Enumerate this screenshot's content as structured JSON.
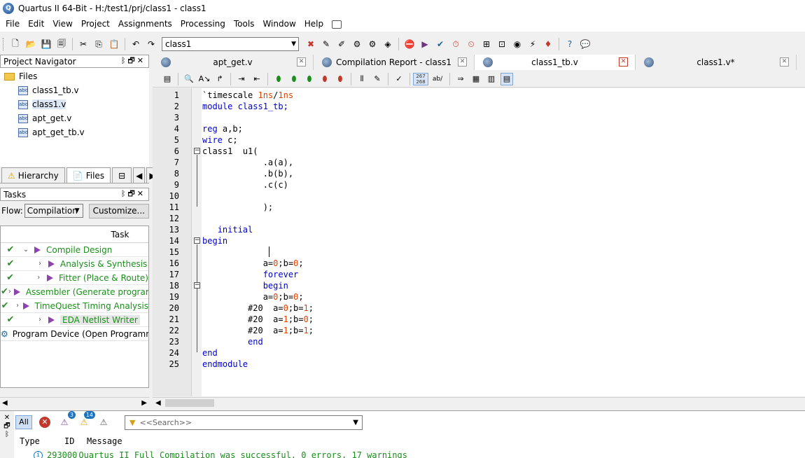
{
  "window": {
    "title": "Quartus II 64-Bit - H:/test1/prj/class1 - class1"
  },
  "menu": [
    "File",
    "Edit",
    "View",
    "Project",
    "Assignments",
    "Processing",
    "Tools",
    "Window",
    "Help"
  ],
  "toolbar": {
    "entity_value": "class1"
  },
  "nav": {
    "title": "Project Navigator",
    "folder": "Files",
    "files": [
      "class1_tb.v",
      "class1.v",
      "apt_get.v",
      "apt_get_tb.v"
    ],
    "selected_index": 1,
    "tabs": [
      "Hierarchy",
      "Files"
    ]
  },
  "tasks": {
    "title": "Tasks",
    "flow_label": "Flow:",
    "flow_value": "Compilation",
    "customize": "Customize...",
    "column": "Task",
    "rows": [
      {
        "label": "Compile Design",
        "done": true,
        "indent": 0
      },
      {
        "label": "Analysis & Synthesis",
        "done": true,
        "indent": 1
      },
      {
        "label": "Fitter (Place & Route)",
        "done": true,
        "indent": 1
      },
      {
        "label": "Assembler (Generate programming files)",
        "done": true,
        "indent": 1
      },
      {
        "label": "TimeQuest Timing Analysis",
        "done": true,
        "indent": 1
      },
      {
        "label": "EDA Netlist Writer",
        "done": true,
        "indent": 1
      },
      {
        "label": "Program Device (Open Programmer)",
        "done": false,
        "indent": 0
      }
    ]
  },
  "editor": {
    "tabs": [
      "apt_get.v",
      "Compilation Report - class1",
      "class1_tb.v",
      "class1.v*"
    ],
    "active_tab": 2,
    "lines_btn": "267\n268",
    "ab_btn": "ab/",
    "lines": [
      [
        [
          "`timescale ",
          ""
        ],
        [
          "1ns",
          "num"
        ],
        [
          "/",
          ""
        ],
        [
          "1ns",
          "num"
        ]
      ],
      [
        [
          "module class1_tb;",
          "kw0"
        ]
      ],
      [],
      [
        [
          "reg",
          "kw"
        ],
        [
          " a,b;",
          ""
        ]
      ],
      [
        [
          "wire",
          "kw"
        ],
        [
          " c;",
          ""
        ]
      ],
      [
        [
          "class1  u1(",
          ""
        ]
      ],
      [
        [
          "            .a(a),",
          ""
        ]
      ],
      [
        [
          "            .b(b),",
          ""
        ]
      ],
      [
        [
          "            .c(c)",
          ""
        ]
      ],
      [],
      [
        [
          "            );",
          ""
        ]
      ],
      [],
      [
        [
          "   ",
          ""
        ],
        [
          "initial",
          "kw"
        ]
      ],
      [
        [
          "begin",
          "kw"
        ]
      ],
      [],
      [
        [
          "            a=",
          ""
        ],
        [
          "0",
          "num"
        ],
        [
          ";b=",
          ""
        ],
        [
          "0",
          "num"
        ],
        [
          ";",
          ""
        ]
      ],
      [
        [
          "            ",
          ""
        ],
        [
          "forever",
          "kw"
        ]
      ],
      [
        [
          "            ",
          ""
        ],
        [
          "begin",
          "kw"
        ]
      ],
      [
        [
          "            a=",
          ""
        ],
        [
          "0",
          "num"
        ],
        [
          ";b=",
          ""
        ],
        [
          "0",
          "num"
        ],
        [
          ";",
          ""
        ]
      ],
      [
        [
          "         #20  a=",
          ""
        ],
        [
          "0",
          "num"
        ],
        [
          ";b=",
          ""
        ],
        [
          "1",
          "num"
        ],
        [
          ";",
          ""
        ]
      ],
      [
        [
          "         #20  a=",
          ""
        ],
        [
          "1",
          "num"
        ],
        [
          ";b=",
          ""
        ],
        [
          "0",
          "num"
        ],
        [
          ";",
          ""
        ]
      ],
      [
        [
          "         #20  a=",
          ""
        ],
        [
          "1",
          "num"
        ],
        [
          ";b=",
          ""
        ],
        [
          "1",
          "num"
        ],
        [
          ";",
          ""
        ]
      ],
      [
        [
          "         ",
          ""
        ],
        [
          "end",
          "kw"
        ]
      ],
      [
        [
          "end",
          "kw"
        ]
      ],
      [
        [
          "endmodule",
          "kw"
        ]
      ]
    ]
  },
  "messages": {
    "all": "All",
    "badge_critical": "3",
    "badge_warning": "14",
    "search_placeholder": "<<Search>>",
    "headers": [
      "Type",
      "ID",
      "Message"
    ],
    "row": {
      "id": "293000",
      "text": "Quartus II Full Compilation was successful. 0 errors, 17 warnings"
    }
  },
  "colors": {
    "keyword": "#0000cc",
    "number": "#e04000",
    "task_text": "#1a8f1a"
  }
}
